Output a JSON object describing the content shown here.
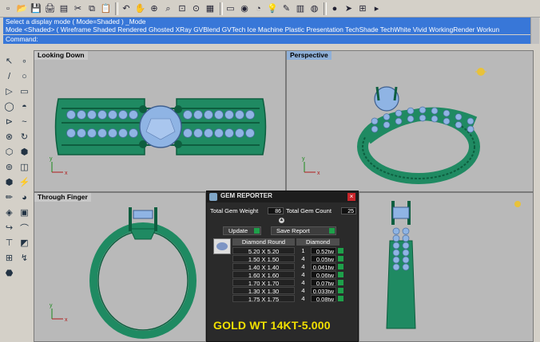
{
  "toolbar": {
    "icons": [
      "new-file",
      "open-file",
      "save-file",
      "print",
      "save-as",
      "cut",
      "copy",
      "paste",
      "undo",
      "pan",
      "zoom-window",
      "zoom-dynamic",
      "zoom-extents",
      "zoom-all",
      "four-viewports",
      "car-shape",
      "eye",
      "lasso",
      "lightbulb",
      "pen",
      "render-box",
      "render-sphere",
      "shaded-sphere",
      "arrow-select",
      "grid-tools",
      "more"
    ],
    "glyphs": [
      "▫",
      "📂",
      "💾",
      "🖨",
      "▤",
      "✂",
      "⧉",
      "📋",
      "↶",
      "✋",
      "⊕",
      "⌕",
      "⊡",
      "⊙",
      "▦",
      "▭",
      "◉",
      "◔",
      "💡",
      "✎",
      "▥",
      "◍",
      "●",
      "➤",
      "⊞",
      "▸"
    ]
  },
  "command": {
    "history_line1": "Select a display mode ( Mode=Shaded )  _Mode",
    "history_line2": "Mode <Shaded> ( Wireframe  Shaded  Rendered  Ghosted  XRay  GVBlend  GVTech  Ice  Machine  Plastic  Presentation  TechShade  TechWhite  Vivid  WorkingRender  Workun",
    "prompt": "Command:"
  },
  "palette": {
    "glyphs": [
      "↖",
      "∘",
      "/",
      "○",
      "▷",
      "▭",
      "◯",
      "◓",
      "⊳",
      "~",
      "⊗",
      "↻",
      "⬡",
      "⬢",
      "⊚",
      "◫",
      "⬢",
      "⚡",
      "✏",
      "◕",
      "◈",
      "▣",
      "↪",
      "⌒",
      "⊤",
      "◩",
      "⊞",
      "↯",
      "⬣"
    ]
  },
  "viewports": {
    "top_left": "Looking Down",
    "top_right": "Perspective",
    "bottom_left": "Through Finger",
    "axis_x": "x",
    "axis_y": "y"
  },
  "gem_reporter": {
    "title": "GEM REPORTER",
    "close": "×",
    "total_weight_label": "Total Gem Weight",
    "total_weight_value": "86",
    "total_count_label": "Total Gem Count",
    "total_count_value": "25",
    "update_label": "Update",
    "save_label": "Save Report",
    "shape_header": "Diamond Round",
    "type_header": "Diamond",
    "rows": [
      {
        "size": "5.20 X 5.20",
        "qty": "1",
        "weight": "0.52tw"
      },
      {
        "size": "1.50 X 1.50",
        "qty": "4",
        "weight": "0.05tw"
      },
      {
        "size": "1.40 X 1.40",
        "qty": "4",
        "weight": "0.041tw"
      },
      {
        "size": "1.60 X 1.60",
        "qty": "4",
        "weight": "0.06tw"
      },
      {
        "size": "1.70 X 1.70",
        "qty": "4",
        "weight": "0.07tw"
      },
      {
        "size": "1.30 X 1.30",
        "qty": "4",
        "weight": "0.033tw"
      },
      {
        "size": "1.75 X 1.75",
        "qty": "4",
        "weight": "0.08tw"
      }
    ],
    "gold_note": "GOLD WT 14KT-5.000"
  },
  "colors": {
    "ring_green": "#1f8a62",
    "ring_dark": "#0e5e3f",
    "gem_blue": "#8fb4e4",
    "command_blue": "#3877d8",
    "viewport_gray": "#b9b9b9",
    "gold_text": "#f2e000"
  }
}
